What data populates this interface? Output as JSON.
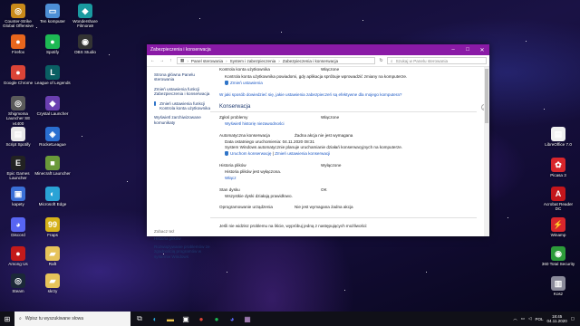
{
  "desktop_left": [
    {
      "label": "Counter-Strike Global Offensive",
      "glyph": "◎",
      "color": "#c98a1a"
    },
    {
      "label": "Ten komputer",
      "glyph": "▭",
      "color": "#4d8fd6"
    },
    {
      "label": "Wondershare Filmora9",
      "glyph": "◆",
      "color": "#1a9aa0"
    },
    {
      "label": "Firefox",
      "glyph": "●",
      "color": "#e8661d"
    },
    {
      "label": "Spotify",
      "glyph": "●",
      "color": "#1db954"
    },
    {
      "label": "OBS Studio",
      "glyph": "◉",
      "color": "#333333"
    },
    {
      "label": "Google Chrome",
      "glyph": "●",
      "color": "#db4437"
    },
    {
      "label": "League of Legends",
      "glyph": "L",
      "color": "#0a5f63"
    },
    {
      "label": "Shigmoma Launcher SE v4400",
      "glyph": "◎",
      "color": "#5a5a5a"
    },
    {
      "label": "Crystal Launcher",
      "glyph": "◆",
      "color": "#6a3fb0"
    },
    {
      "label": "Script Spotify",
      "glyph": "▤",
      "color": "#e8e8e8"
    },
    {
      "label": "RocketLeague",
      "glyph": "◈",
      "color": "#2a6fd0"
    },
    {
      "label": "Epic Games Launcher",
      "glyph": "E",
      "color": "#222222"
    },
    {
      "label": "Minecraft Launcher",
      "glyph": "■",
      "color": "#6a9a3a"
    },
    {
      "label": "kapety",
      "glyph": "▣",
      "color": "#3a6fd6"
    },
    {
      "label": "Microsoft Edge",
      "glyph": "◐",
      "color": "#2aa3d6"
    },
    {
      "label": "Discord",
      "glyph": "◕",
      "color": "#5865f2"
    },
    {
      "label": "Fraps",
      "glyph": "99",
      "color": "#d6b21a"
    },
    {
      "label": "Among Us",
      "glyph": "●",
      "color": "#c31a1a"
    },
    {
      "label": "Raft",
      "glyph": "▰",
      "color": "#e6c35a"
    },
    {
      "label": "Steam",
      "glyph": "◎",
      "color": "#1b2838"
    },
    {
      "label": "skrzy",
      "glyph": "▰",
      "color": "#e6c35a"
    }
  ],
  "desktop_right": [
    {
      "label": "LibreOffice 7.0",
      "glyph": "▤",
      "color": "#f0f0f0"
    },
    {
      "label": "Picasa 3",
      "glyph": "✿",
      "color": "#d8262c"
    },
    {
      "label": "Acrobat Reader DC",
      "glyph": "A",
      "color": "#c4161c"
    },
    {
      "label": "Winamp",
      "glyph": "⚡",
      "color": "#d8262c"
    },
    {
      "label": "360 Total Security",
      "glyph": "◉",
      "color": "#2d9b3a"
    },
    {
      "label": "Kosz",
      "glyph": "▥",
      "color": "#8a8a9a"
    }
  ],
  "window": {
    "title": "Zabezpieczenia i konserwacja",
    "breadcrumb": [
      "Panel sterowania",
      "System i zabezpieczenia",
      "Zabezpieczenia i konserwacja"
    ],
    "search_placeholder": "Szukaj w Panelu sterowania",
    "left_links": [
      "Strona główna Panelu sterowania",
      "Zmień ustawienia funkcji Zabezpieczenia i konserwacja",
      "Zmień ustawienia funkcji Kontrola konta użytkownika",
      "Wyświetl zarchiwizowane komunikaty"
    ],
    "see_also": {
      "header": "Zobacz też",
      "items": [
        "Historia plików",
        "Rozwiązywanie problemów ze zgodnością programów w systemie Windows"
      ]
    },
    "uac": {
      "label": "Kontrola konta użytkownika",
      "value": "Włączone",
      "desc": "Kontrola konta użytkownika powiadomi, gdy aplikacja spróbuje wprowadzić zmiany na komputerze.",
      "link": "Zmień ustawienia"
    },
    "help_link": "W jaki sposób dowiedzieć się, jakie ustawienia zabezpieczeń są efektywne dla mojego komputera?",
    "maintenance": {
      "heading": "Konserwacja",
      "problems_label": "Zgłoś problemy",
      "problems_value": "Włączone",
      "problems_link": "Wyświetl historię niezawodności",
      "auto_label": "Automatyczna konserwacja",
      "auto_value": "Żadna akcja nie jest wymagana",
      "auto_last": "Data ostatniego uruchomienia: 04.11.2020 08:31",
      "auto_desc": "System Windows automatycznie planuje uruchamianie działań konserwacyjnych na komputerze.",
      "auto_start": "Uruchom konserwację",
      "auto_change": "Zmień ustawienia konserwacji",
      "history_label": "Historia plików",
      "history_value": "Wyłączone",
      "history_desc": "Historia plików jest wyłączona.",
      "history_link": "Włącz",
      "drive_label": "Stan dysku",
      "drive_value": "OK",
      "drive_desc": "Wszystkie dyski działają prawidłowo.",
      "device_label": "Oprogramowanie urządzenia",
      "device_value": "Nie jest wymagana żadna akcja"
    },
    "footer": "Jeśli nie widzisz problemu na liście, wypróbuj jedną z następujących możliwości:"
  },
  "taskbar": {
    "search_placeholder": "Wpisz tu wyszukiwane słowa",
    "lang": "POL",
    "time": "18:45",
    "date": "04.11.2020"
  }
}
